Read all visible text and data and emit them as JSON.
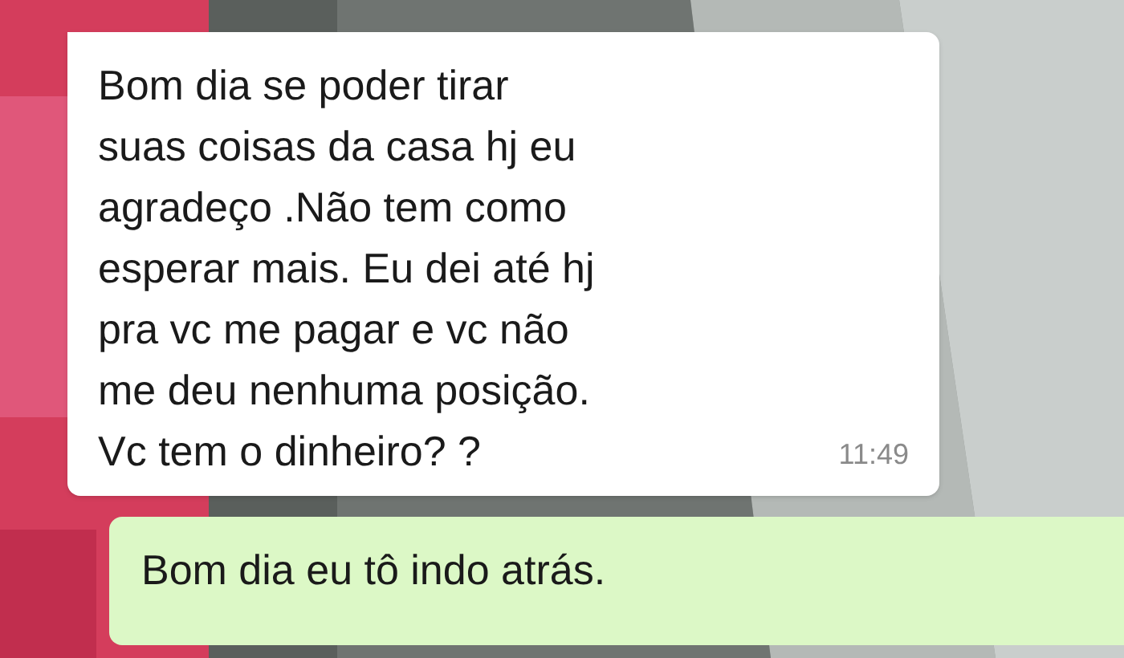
{
  "messages": [
    {
      "kind": "incoming",
      "lines": [
        "Bom dia se poder tirar",
        "suas coisas da casa hj eu",
        "agradeço .Não tem como",
        "esperar mais. Eu dei até hj",
        "pra vc me pagar e vc não",
        "me deu nenhuma posição.",
        "Vc tem o dinheiro? ?"
      ],
      "time": "11:49"
    },
    {
      "kind": "outgoing",
      "lines": [
        "Bom dia eu tô indo atrás."
      ]
    }
  ]
}
